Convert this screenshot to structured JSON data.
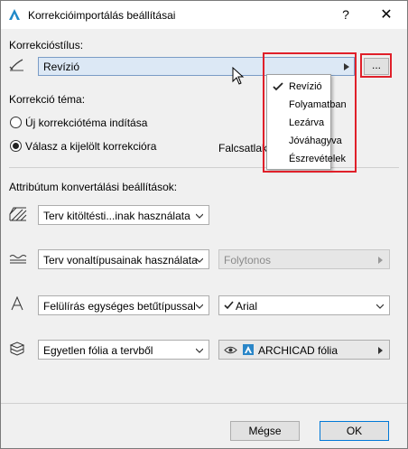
{
  "window": {
    "title": "Korrekcióimportálás beállításai",
    "help_label": "?",
    "close_label": "✕"
  },
  "style_section": {
    "label": "Korrekcióstílus:",
    "selected": "Revízió",
    "more_button": "..."
  },
  "dropdown": {
    "items": [
      {
        "label": "Revízió",
        "checked": true
      },
      {
        "label": "Folyamatban",
        "checked": false
      },
      {
        "label": "Lezárva",
        "checked": false
      },
      {
        "label": "Jóváhagyva",
        "checked": false
      },
      {
        "label": "Észrevételek",
        "checked": false
      }
    ]
  },
  "topic_section": {
    "label": "Korrekció téma:",
    "radio_new": "Új korrekciótéma indítása",
    "radio_reply": "Válasz a kijelölt korrekcióra",
    "selected_option": "reply",
    "partial_text": "Falcsatlak"
  },
  "attr_section": {
    "label": "Attribútum konvertálási beállítások:",
    "fill_select": "Terv kitöltésti...inak használata",
    "line_select": "Terv vonaltípusainak használata",
    "line_value": "Folytonos",
    "font_select": "Felülírás egységes betűtípussal",
    "font_value": "Arial",
    "layer_select": "Egyetlen fólia a tervből",
    "layer_value": "ARCHICAD fólia"
  },
  "buttons": {
    "cancel": "Mégse",
    "ok": "OK"
  },
  "colors": {
    "highlight_red": "#e0202a",
    "field_blue": "#dce8f5",
    "app_icon_blue": "#1e88c8"
  }
}
